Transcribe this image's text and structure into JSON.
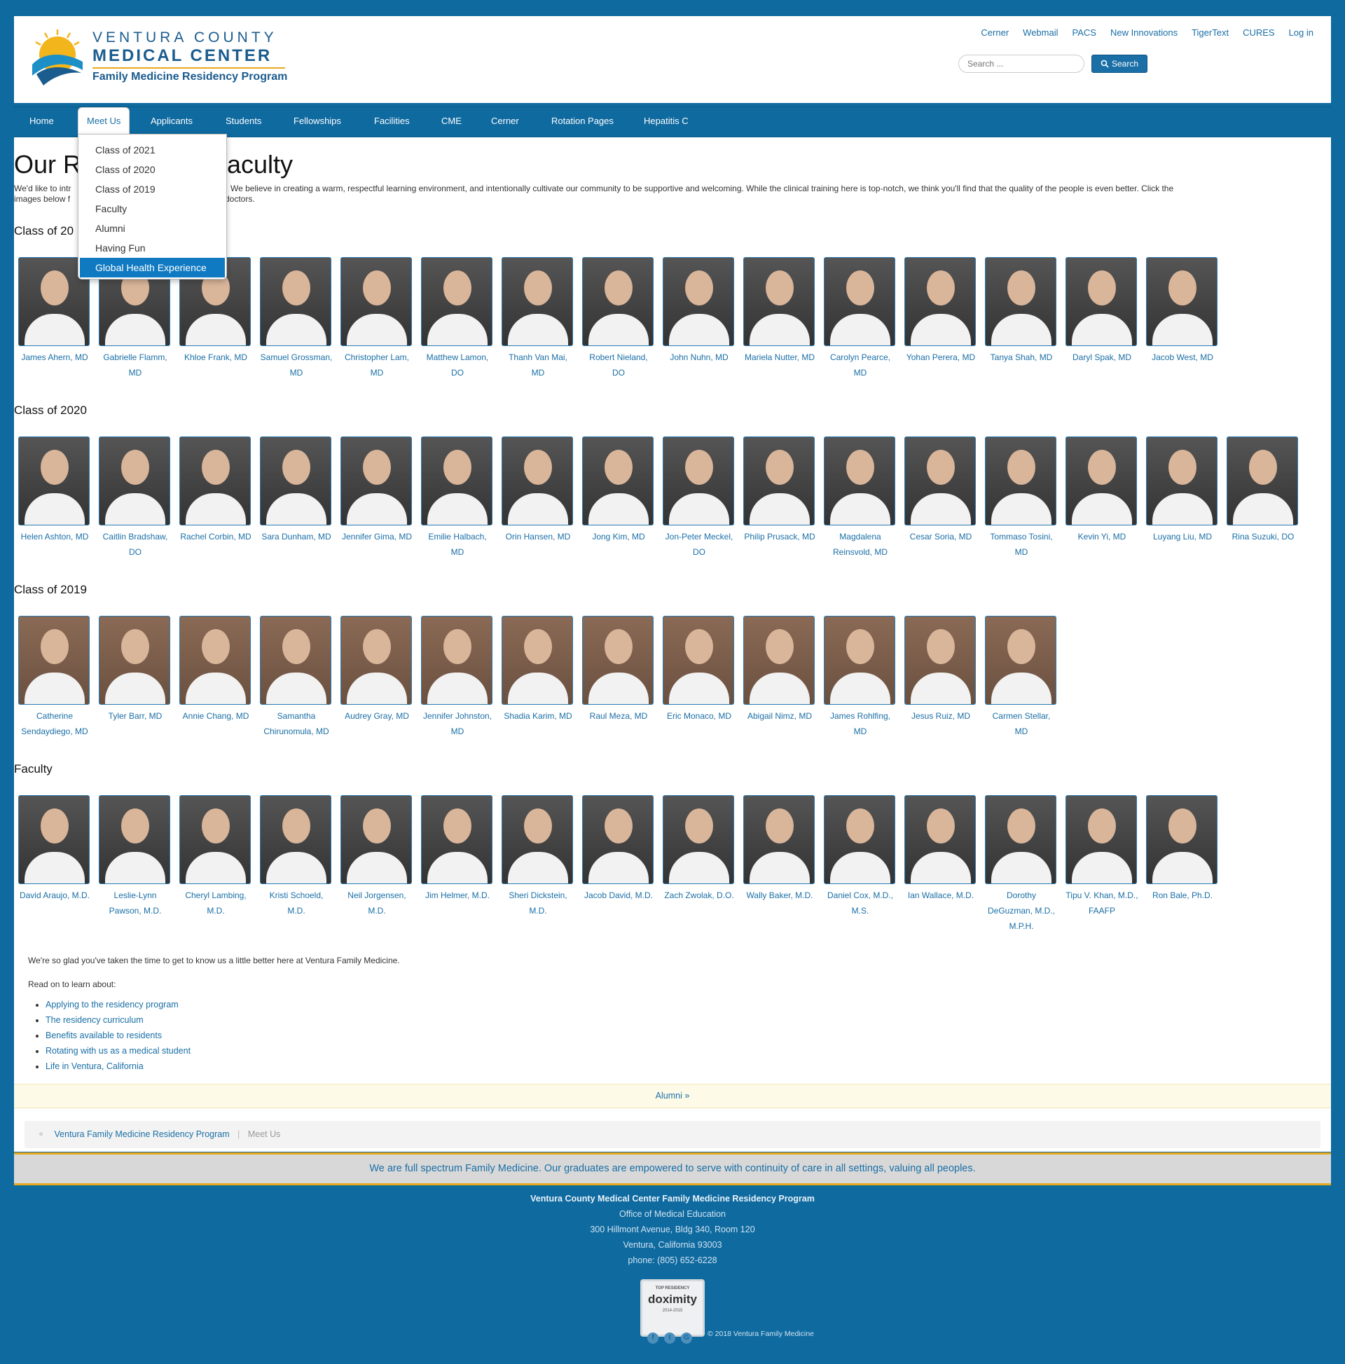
{
  "header": {
    "logo_line1": "VENTURA COUNTY",
    "logo_line2": "MEDICAL CENTER",
    "logo_line3": "Family Medicine Residency Program",
    "top_links": [
      "Cerner",
      "Webmail",
      "PACS",
      "New Innovations",
      "TigerText",
      "CURES",
      "Log in"
    ],
    "search_placeholder": "Search ...",
    "search_button": "Search"
  },
  "nav": {
    "items": [
      "Home",
      "Meet Us",
      "Applicants",
      "Students",
      "Fellowships",
      "Facilities",
      "CME",
      "Cerner",
      "Rotation Pages",
      "Hepatitis C"
    ],
    "active": "Meet Us",
    "dropdown": [
      "Class of 2021",
      "Class of 2020",
      "Class of 2019",
      "Faculty",
      "Alumni",
      "Having Fun",
      "Global Health Experience"
    ],
    "dropdown_selected": "Global Health Experience"
  },
  "page": {
    "title": "Our R",
    "title_tail": "Faculty",
    "intro_left": "We'd like to intr",
    "intro_right": "We believe in creating a warm, respectful learning environment, and intentionally cultivate our community to be supportive and welcoming.  While the clinical training here is top-notch, we think you'll find that the quality of the people is even better.  Click the",
    "intro_line2_left": "images below f",
    "intro_line2_right": "doctors."
  },
  "sections": [
    {
      "heading": "Class of 20",
      "people": [
        "James Ahern, MD",
        "Gabrielle Flamm, MD",
        "Khloe Frank, MD",
        "Samuel Grossman, MD",
        "Christopher Lam, MD",
        "Matthew Lamon, DO",
        "Thanh Van Mai, MD",
        "Robert Nieland, DO",
        "John Nuhn, MD",
        "Mariela Nutter, MD",
        "Carolyn Pearce, MD",
        "Yohan Perera, MD",
        "Tanya Shah, MD",
        "Daryl Spak, MD",
        "Jacob West, MD"
      ]
    },
    {
      "heading": "Class of 2020",
      "people": [
        "Helen Ashton, MD",
        "Caitlin Bradshaw, DO",
        "Rachel Corbin, MD",
        "Sara Dunham, MD",
        "Jennifer Gima, MD",
        "Emilie Halbach, MD",
        "Orin Hansen, MD",
        "Jong Kim, MD",
        "Jon-Peter Meckel, DO",
        "Philip Prusack, MD",
        "Magdalena Reinsvold, MD",
        "Cesar Soria, MD",
        "Tommaso Tosini, MD",
        "Kevin Yi, MD",
        "Luyang Liu, MD",
        "Rina Suzuki, DO"
      ]
    },
    {
      "heading": "Class of 2019",
      "people": [
        "Catherine Sendaydiego, MD",
        "Tyler Barr, MD",
        "Annie Chang, MD",
        "Samantha Chirunomula, MD",
        "Audrey Gray, MD",
        "Jennifer Johnston, MD",
        "Shadia Karim, MD",
        "Raul Meza, MD",
        "Eric Monaco, MD",
        "Abigail Nimz, MD",
        "James Rohlfing, MD",
        "Jesus Ruiz, MD",
        "Carmen Stellar, MD"
      ]
    },
    {
      "heading": "Faculty",
      "people": [
        "David Araujo, M.D.",
        "Leslie-Lynn Pawson, M.D.",
        "Cheryl Lambing, M.D.",
        "Kristi Schoeld, M.D.",
        "Neil Jorgensen, M.D.",
        "Jim Helmer, M.D.",
        "Sheri Dickstein, M.D.",
        "Jacob David, M.D.",
        "Zach Zwolak, D.O.",
        "Wally Baker, M.D.",
        "Daniel Cox, M.D., M.S.",
        "Ian Wallace, M.D.",
        "Dorothy DeGuzman, M.D., M.P.H.",
        "Tipu V. Khan, M.D., FAAFP",
        "Ron Bale, Ph.D."
      ]
    }
  ],
  "closing": {
    "glad": "We're so glad you've taken the time to get to know us a little better here at Ventura Family Medicine.",
    "read_on": "Read on to learn about:",
    "links": [
      "Applying to the residency program",
      "The residency curriculum",
      "Benefits available to residents",
      "Rotating with us as a medical student",
      "Life in Ventura, California"
    ],
    "alumni_link": "Alumni »"
  },
  "breadcrumb": {
    "home": "Ventura Family Medicine Residency Program",
    "current": "Meet Us"
  },
  "tagline": "We are full spectrum Family Medicine. Our graduates are empowered to serve with continuity of care in all settings, valuing all peoples.",
  "footer": {
    "org": "Ventura County Medical Center Family Medicine Residency Program",
    "office": "Office of Medical Education",
    "address1": "300 Hillmont Avenue, Bldg 340, Room 120",
    "address2": "Ventura, California 93003",
    "phone": "phone: (805) 652-6228",
    "badge_top": "TOP RESIDENCY",
    "badge_word": "doximity",
    "badge_years": "2014-2015",
    "copyright": "© 2018 Ventura Family Medicine"
  },
  "colors": {
    "brand_blue": "#0f6aa0",
    "link_blue": "#1a6fa6",
    "accent_gold": "#e8a81e"
  }
}
